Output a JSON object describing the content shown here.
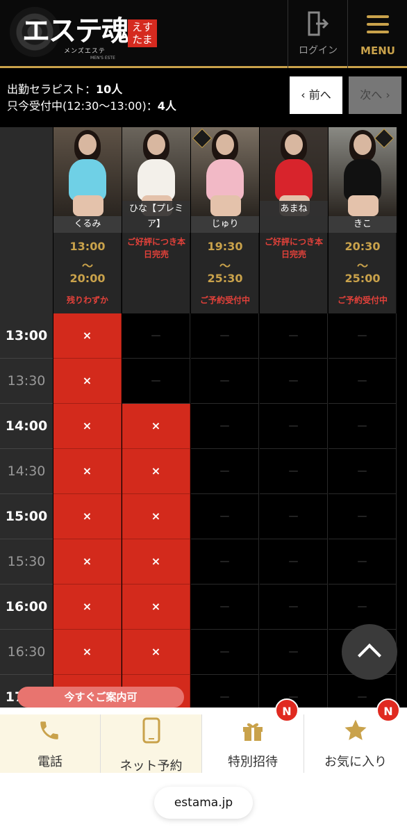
{
  "header": {
    "logo_text": "エステ魂",
    "logo_seal": "えすたま",
    "logo_sub": "メンズエステ",
    "logo_sub2": "MEN'S ESTE",
    "login_label": "ログイン",
    "menu_label": "MENU",
    "accent": "#c9a24b"
  },
  "info": {
    "attendance_label": "出勤セラピスト：",
    "attendance_count": "10人",
    "accepting_label": "只今受付中(12:30〜13:00)：",
    "accepting_count": "4人",
    "prev_label": "‹ 前へ",
    "next_label": "次へ ›"
  },
  "therapists": [
    {
      "name": "くるみ",
      "start": "13:00",
      "sep": "〜",
      "end": "20:00",
      "status": "残りわずか",
      "dress": "#6fd0e6",
      "bg": "#5e5246",
      "badge": false
    },
    {
      "name": "ひな【プレミア】",
      "sold_out": "ご好評につき本日完売",
      "dress": "#f3f0ea",
      "bg": "#6b655c",
      "badge": false
    },
    {
      "name": "じゅり",
      "start": "19:30",
      "sep": "〜",
      "end": "25:30",
      "status": "ご予約受付中",
      "dress": "#f2b9c6",
      "bg": "#7a6f62",
      "badge": true
    },
    {
      "name": "あまね",
      "sold_out": "ご好評につき本日完売",
      "dress": "#d8242c",
      "bg": "#3c3530",
      "badge": false
    },
    {
      "name": "きこ",
      "start": "20:30",
      "sep": "〜",
      "end": "25:00",
      "status": "ご予約受付中",
      "dress": "#111111",
      "bg": "#8a8a84",
      "badge": true
    }
  ],
  "schedule": {
    "booked_mark": "×",
    "open_mark": "—",
    "rows": [
      {
        "time": "13:00",
        "hour": true,
        "cells": [
          "x",
          "o",
          "o",
          "o",
          "o"
        ]
      },
      {
        "time": "13:30",
        "hour": false,
        "cells": [
          "x",
          "o",
          "o",
          "o",
          "o"
        ]
      },
      {
        "time": "14:00",
        "hour": true,
        "cells": [
          "x",
          "x",
          "o",
          "o",
          "o"
        ]
      },
      {
        "time": "14:30",
        "hour": false,
        "cells": [
          "x",
          "x",
          "o",
          "o",
          "o"
        ]
      },
      {
        "time": "15:00",
        "hour": true,
        "cells": [
          "x",
          "x",
          "o",
          "o",
          "o"
        ]
      },
      {
        "time": "15:30",
        "hour": false,
        "cells": [
          "x",
          "x",
          "o",
          "o",
          "o"
        ]
      },
      {
        "time": "16:00",
        "hour": true,
        "cells": [
          "x",
          "x",
          "o",
          "o",
          "o"
        ]
      },
      {
        "time": "16:30",
        "hour": false,
        "cells": [
          "x",
          "x",
          "o",
          "o",
          "o"
        ]
      },
      {
        "time": "17:00",
        "hour": true,
        "cells": [
          "x",
          "x",
          "o",
          "o",
          "o"
        ]
      }
    ],
    "booked_color": "#d32a1c"
  },
  "bottom": {
    "now_pill": "今すぐご案内可",
    "tabs": [
      {
        "label": "電話",
        "icon": "phone-icon"
      },
      {
        "label": "ネット予約",
        "icon": "smartphone-icon"
      },
      {
        "label": "特別招待",
        "icon": "gift-icon",
        "badge": "N"
      },
      {
        "label": "お気に入り",
        "icon": "star-icon",
        "badge": "N"
      }
    ]
  },
  "browser": {
    "url": "estama.jp"
  }
}
